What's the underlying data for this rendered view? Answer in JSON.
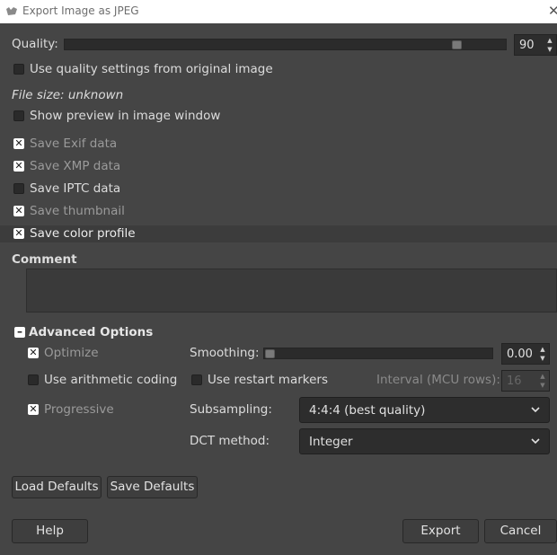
{
  "window": {
    "title": "Export Image as JPEG",
    "close_glyph": "✕"
  },
  "quality": {
    "label": "Quality:",
    "value": "90",
    "fraction": 0.9
  },
  "use_original_quality": {
    "label": "Use quality settings from original image",
    "checked": false
  },
  "file_size": "File size: unknown",
  "show_preview": {
    "label": "Show preview in image window",
    "checked": false
  },
  "metadata": {
    "exif": {
      "label": "Save Exif data",
      "checked": true
    },
    "xmp": {
      "label": "Save XMP data",
      "checked": true
    },
    "iptc": {
      "label": "Save IPTC data",
      "checked": false
    },
    "thumbnail": {
      "label": "Save thumbnail",
      "checked": true
    },
    "color_profile": {
      "label": "Save color profile",
      "checked": true
    }
  },
  "comment": {
    "label": "Comment",
    "value": ""
  },
  "advanced": {
    "label": "Advanced Options",
    "optimize": {
      "label": "Optimize",
      "checked": true
    },
    "arithmetic": {
      "label": "Use arithmetic coding",
      "checked": false
    },
    "progressive": {
      "label": "Progressive",
      "checked": true
    },
    "smoothing": {
      "label": "Smoothing:",
      "value": "0.00",
      "fraction": 0.0
    },
    "restart": {
      "label": "Use restart markers",
      "checked": false
    },
    "interval": {
      "label": "Interval (MCU rows):",
      "value": "16"
    },
    "subsampling": {
      "label": "Subsampling:",
      "value": "4:4:4 (best quality)"
    },
    "dct": {
      "label": "DCT method:",
      "value": "Integer"
    }
  },
  "buttons": {
    "load_defaults": "Load Defaults",
    "save_defaults": "Save Defaults",
    "help": "Help",
    "export": "Export",
    "cancel": "Cancel"
  },
  "glyphs": {
    "check": "✕",
    "minus": "–",
    "up": "▲",
    "down": "▼"
  }
}
